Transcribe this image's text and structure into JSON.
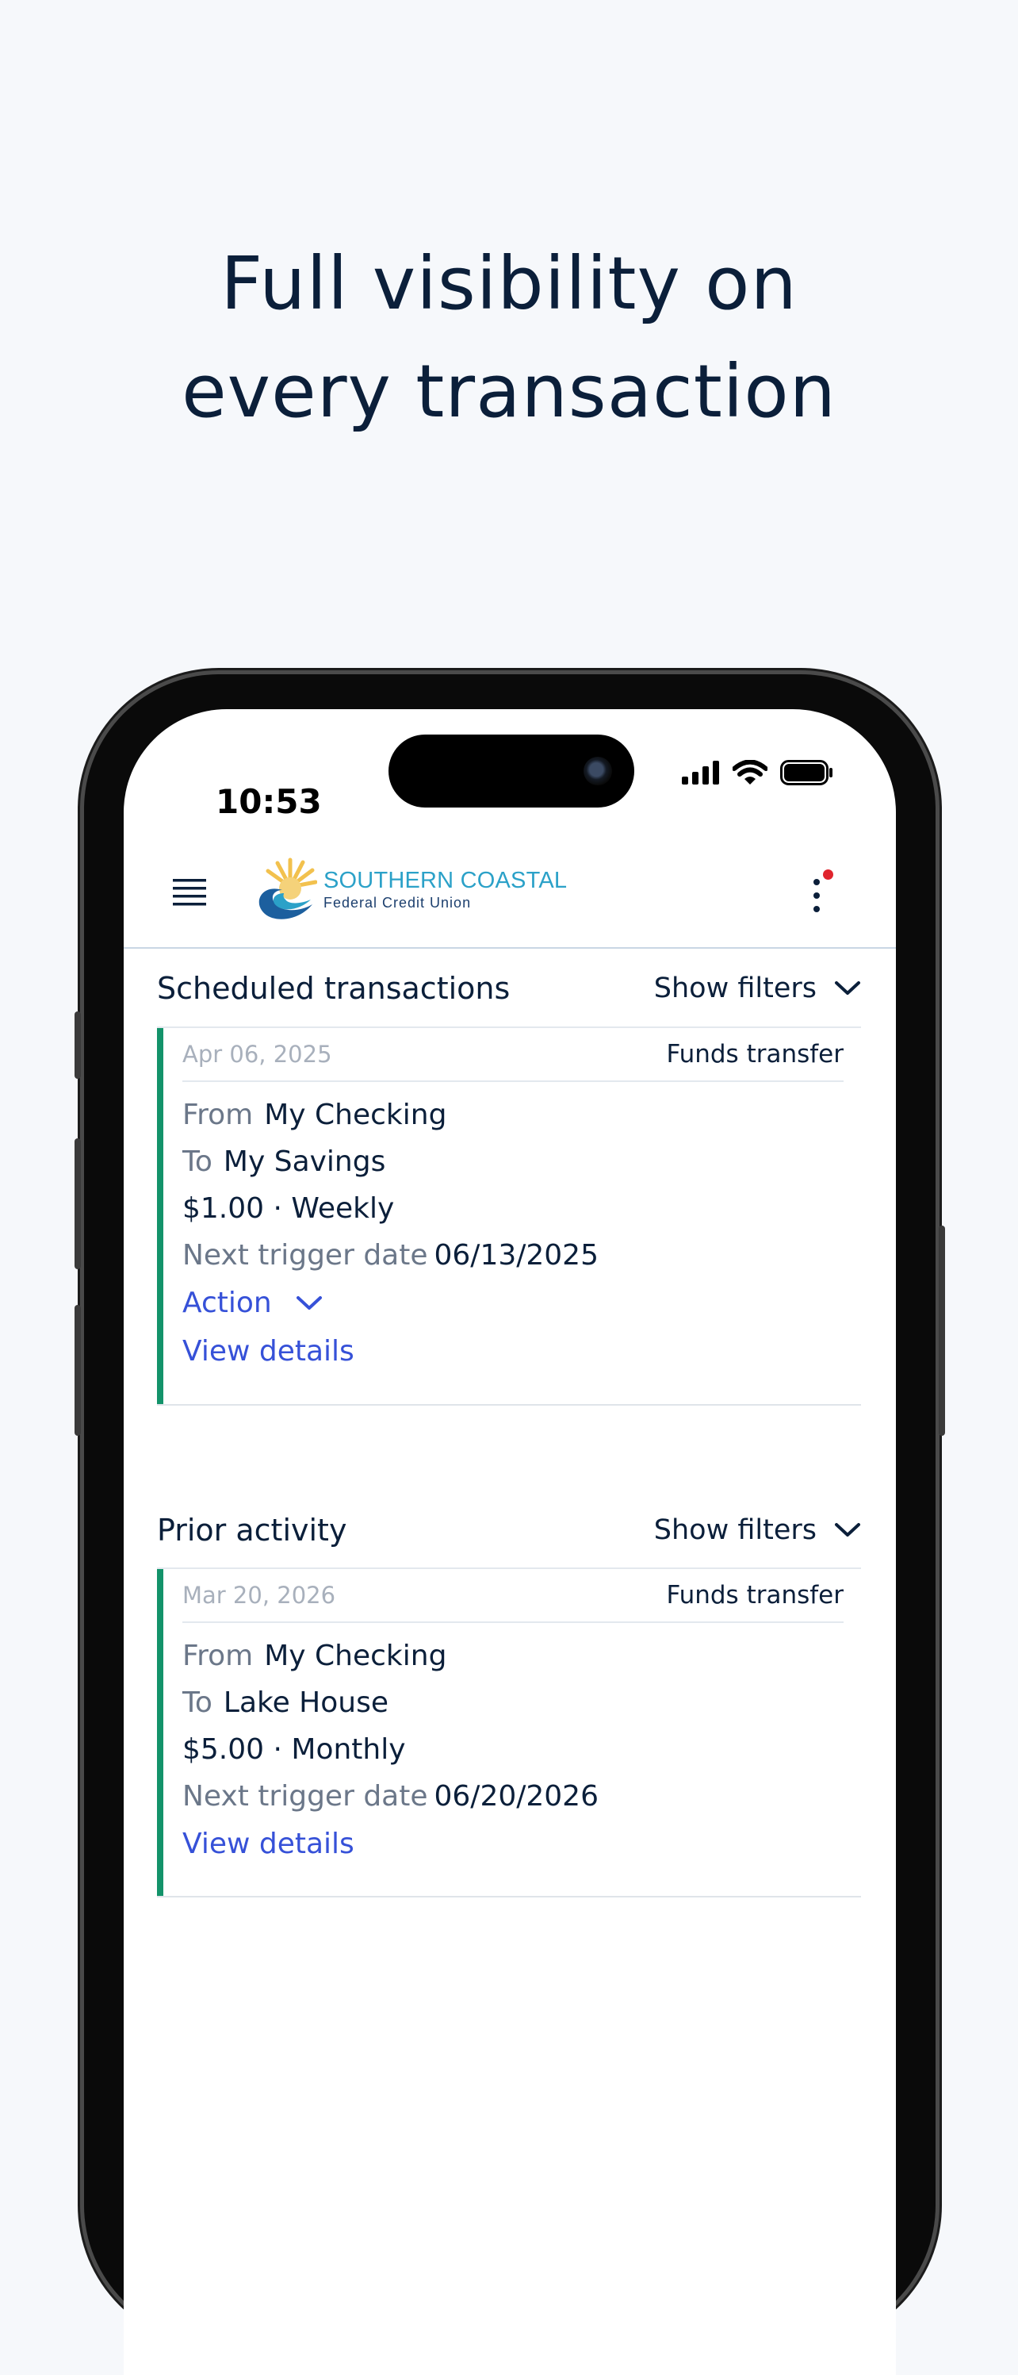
{
  "hero": {
    "line1": "Full visibility on",
    "line2": "every transaction"
  },
  "status_bar": {
    "time": "10:53"
  },
  "header": {
    "logo_name": "SOUTHERN COASTAL",
    "logo_subtitle": "Federal Credit Union",
    "menu_icon": "hamburger-menu-icon",
    "more_icon": "kebab-menu-icon",
    "notification_color": "#e0242d"
  },
  "scheduled": {
    "title": "Scheduled transactions",
    "filters_label": "Show filters",
    "card": {
      "date": "Apr 06, 2025",
      "type": "Funds transfer",
      "from_label": "From",
      "from_value": "My Checking",
      "to_label": "To",
      "to_value": "My Savings",
      "amount_freq": "$1.00 · Weekly",
      "next_label": "Next trigger date",
      "next_value": "06/13/2025",
      "action_label": "Action",
      "details_label": "View details"
    }
  },
  "prior": {
    "title": "Prior activity",
    "filters_label": "Show filters",
    "card": {
      "date": "Mar 20, 2026",
      "type": "Funds transfer",
      "from_label": "From",
      "from_value": "My Checking",
      "to_label": "To",
      "to_value": "Lake House",
      "amount_freq": "$5.00 · Monthly",
      "next_label": "Next trigger date",
      "next_value": "06/20/2026",
      "details_label": "View details"
    }
  },
  "colors": {
    "accent_bar": "#13936a",
    "link": "#3651d8",
    "text_primary": "#0b1f3a",
    "logo_blue": "#2ba1c8"
  }
}
